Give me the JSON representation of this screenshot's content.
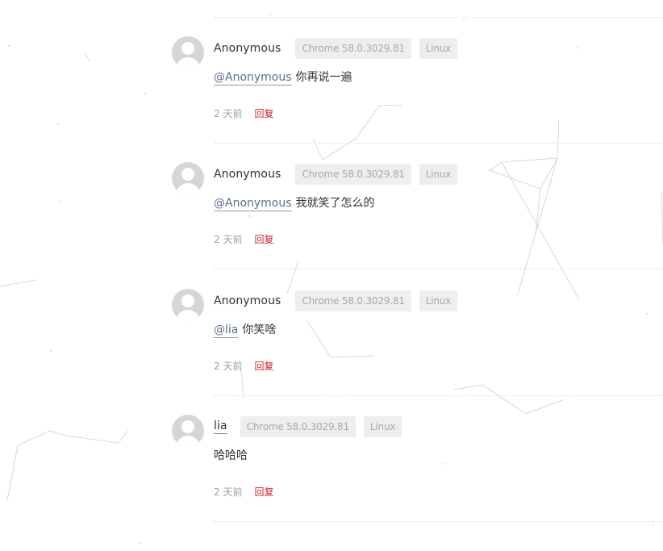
{
  "comments": [
    {
      "author": "Anonymous",
      "browser": "Chrome 58.0.3029.81",
      "os": "Linux",
      "mention": "@Anonymous",
      "text": "你再说一遍",
      "time": "2 天前",
      "reply_label": "回复"
    },
    {
      "author": "Anonymous",
      "browser": "Chrome 58.0.3029.81",
      "os": "Linux",
      "mention": "@Anonymous",
      "text": "我就笑了怎么的",
      "time": "2 天前",
      "reply_label": "回复"
    },
    {
      "author": "Anonymous",
      "browser": "Chrome 58.0.3029.81",
      "os": "Linux",
      "mention": "@lia",
      "text": "你笑啥",
      "time": "2 天前",
      "reply_label": "回复"
    },
    {
      "author": "lia",
      "browser": "Chrome 58.0.3029.81",
      "os": "Linux",
      "mention": "",
      "text": "哈哈哈",
      "time": "2 天前",
      "reply_label": "回复"
    }
  ]
}
